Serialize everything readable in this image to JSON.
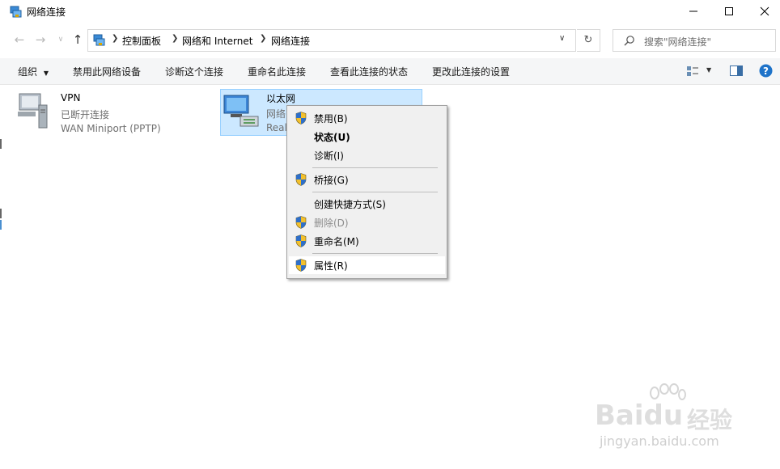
{
  "window": {
    "title": "网络连接"
  },
  "address": {
    "crumbs": [
      "控制面板",
      "网络和 Internet",
      "网络连接"
    ],
    "search_placeholder": "搜索\"网络连接\""
  },
  "toolbar": {
    "organize": "组织",
    "items": [
      "禁用此网络设备",
      "诊断这个连接",
      "重命名此连接",
      "查看此连接的状态",
      "更改此连接的设置"
    ]
  },
  "connections": [
    {
      "name": "VPN",
      "status": "已断开连接",
      "device": "WAN Miniport (PPTP)"
    },
    {
      "name": "以太网",
      "status": "网络",
      "device": "Real"
    }
  ],
  "context_menu": {
    "disable": "禁用(B)",
    "status": "状态(U)",
    "diagnose": "诊断(I)",
    "bridge": "桥接(G)",
    "shortcut": "创建快捷方式(S)",
    "delete": "删除(D)",
    "rename": "重命名(M)",
    "properties": "属性(R)"
  },
  "watermark": {
    "brand": "Baidu",
    "suffix": "经验",
    "url": "jingyan.baidu.com"
  },
  "colors": {
    "accent": "#0078d7",
    "selection": "#cce8ff",
    "selection_border": "#99d1ff",
    "menu_bg": "#f0f0f0"
  },
  "icons": [
    "network-folder-icon",
    "back-arrow-icon",
    "forward-arrow-icon",
    "up-arrow-icon",
    "refresh-icon",
    "search-icon",
    "shield-icon",
    "help-icon",
    "view-options-icon",
    "preview-pane-icon"
  ]
}
